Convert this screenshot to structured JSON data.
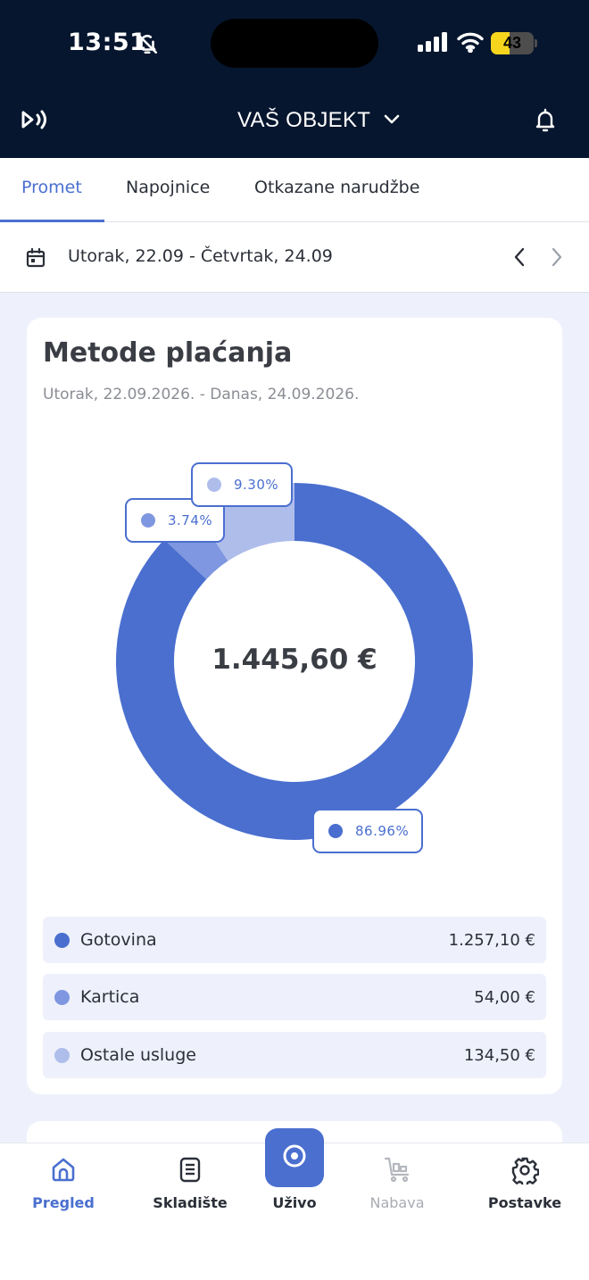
{
  "status_bar": {
    "time": "13:51",
    "battery": "43",
    "battery_level": 0.43
  },
  "header": {
    "venue_title": "VAŠ OBJEKT"
  },
  "tabs": [
    {
      "label": "Promet",
      "active": true
    },
    {
      "label": "Napojnice",
      "active": false
    },
    {
      "label": "Otkazane narudžbe",
      "active": false
    }
  ],
  "date_bar": {
    "range": "Utorak, 22.09 - Četvrtak, 24.09"
  },
  "card": {
    "title": "Metode plaćanja",
    "subtitle": "Utorak, 22.09.2026. - Danas, 24.09.2026.",
    "total": "1.445,60 €"
  },
  "chart_data": {
    "type": "pie",
    "categories": [
      "Gotovina",
      "Kartica",
      "Ostale usluge"
    ],
    "values": [
      86.96,
      3.74,
      9.3
    ],
    "value_labels": [
      "86.96%",
      "3.74%",
      "9.30%"
    ],
    "colors": [
      "#4a6fcf",
      "#7f97e0",
      "#afbdeb"
    ]
  },
  "legend": [
    {
      "label": "Gotovina",
      "value": "1.257,10 €",
      "color": "#4a6fcf"
    },
    {
      "label": "Kartica",
      "value": "54,00 €",
      "color": "#7f97e0"
    },
    {
      "label": "Ostale usluge",
      "value": "134,50 €",
      "color": "#afbdeb"
    }
  ],
  "bottom_nav": {
    "items": [
      {
        "label": "Pregled",
        "icon": "home-icon",
        "state": "active"
      },
      {
        "label": "Skladište",
        "icon": "archive-icon",
        "state": "normal"
      },
      {
        "label": "Uživo",
        "icon": "target-icon",
        "state": "featured"
      },
      {
        "label": "Nabava",
        "icon": "cart-icon",
        "state": "disabled"
      },
      {
        "label": "Postavke",
        "icon": "gear-icon",
        "state": "normal"
      }
    ]
  },
  "colors": {
    "primary": "#4a6fcf",
    "header_bg": "#06162e",
    "content_bg": "#eef1fb"
  }
}
